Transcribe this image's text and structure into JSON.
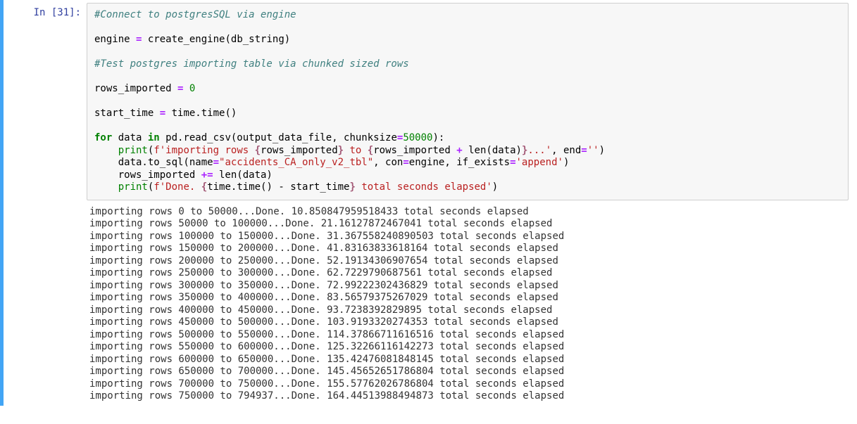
{
  "prompt": "In [31]:",
  "code": {
    "l1_comment": "#Connect to postgresSQL via engine",
    "l3_lhs": "engine ",
    "l3_eq": "=",
    "l3_rhs": " create_engine(db_string)",
    "l5_comment": "#Test postgres importing table via chunked sized rows",
    "l7_lhs": "rows_imported ",
    "l7_eq": "=",
    "l7_sp": " ",
    "l7_num": "0",
    "l9_lhs": "start_time ",
    "l9_eq": "=",
    "l9_rhs": " time.time()",
    "l11_for": "for",
    "l11_mid": " data ",
    "l11_in": "in",
    "l11_rest1": " pd.read_csv(output_data_file, chunksize",
    "l11_eq": "=",
    "l11_num": "50000",
    "l11_close": "):",
    "l12_indent": "    ",
    "l12_print": "print",
    "l12_open": "(",
    "l12_fpre": "f'importing rows ",
    "l12_i1o": "{",
    "l12_i1": "rows_imported",
    "l12_i1c": "}",
    "l12_mid": " to ",
    "l12_i2o": "{",
    "l12_i2a": "rows_imported ",
    "l12_i2plus": "+",
    "l12_i2b": " len(data)",
    "l12_i2c": "}",
    "l12_post": "...'",
    "l12_comma": ", end",
    "l12_eq": "=",
    "l12_end": "''",
    "l12_close": ")",
    "l13_indent": "    data.to_sql(name",
    "l13_eq1": "=",
    "l13_name": "\"accidents_CA_only_v2_tbl\"",
    "l13_mid1": ", con",
    "l13_eq2": "=",
    "l13_mid2": "engine, if_exists",
    "l13_eq3": "=",
    "l13_append": "'append'",
    "l13_close": ")",
    "l14_indent": "    rows_imported ",
    "l14_op": "+=",
    "l14_rhs": " len(data)",
    "l15_indent": "    ",
    "l15_print": "print",
    "l15_open": "(",
    "l15_fpre": "f'Done. ",
    "l15_i1o": "{",
    "l15_i1": "time.time() - start_time",
    "l15_i1c": "}",
    "l15_post": " total seconds elapsed'",
    "l15_close": ")"
  },
  "output_lines": [
    "importing rows 0 to 50000...Done. 10.850847959518433 total seconds elapsed",
    "importing rows 50000 to 100000...Done. 21.16127872467041 total seconds elapsed",
    "importing rows 100000 to 150000...Done. 31.367558240890503 total seconds elapsed",
    "importing rows 150000 to 200000...Done. 41.83163833618164 total seconds elapsed",
    "importing rows 200000 to 250000...Done. 52.19134306907654 total seconds elapsed",
    "importing rows 250000 to 300000...Done. 62.7229790687561 total seconds elapsed",
    "importing rows 300000 to 350000...Done. 72.99222302436829 total seconds elapsed",
    "importing rows 350000 to 400000...Done. 83.56579375267029 total seconds elapsed",
    "importing rows 400000 to 450000...Done. 93.7238392829895 total seconds elapsed",
    "importing rows 450000 to 500000...Done. 103.9193320274353 total seconds elapsed",
    "importing rows 500000 to 550000...Done. 114.37866711616516 total seconds elapsed",
    "importing rows 550000 to 600000...Done. 125.32266116142273 total seconds elapsed",
    "importing rows 600000 to 650000...Done. 135.42476081848145 total seconds elapsed",
    "importing rows 650000 to 700000...Done. 145.45652651786804 total seconds elapsed",
    "importing rows 700000 to 750000...Done. 155.57762026786804 total seconds elapsed",
    "importing rows 750000 to 794937...Done. 164.44513988494873 total seconds elapsed"
  ]
}
